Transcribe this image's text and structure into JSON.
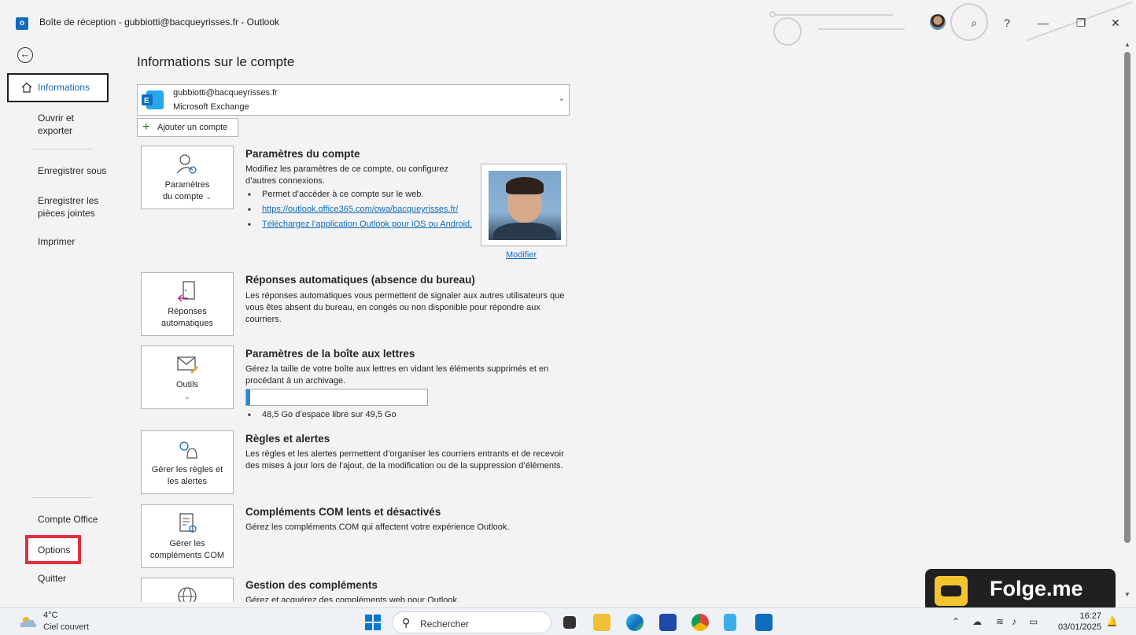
{
  "titlebar": {
    "title": "Boîte de réception - gubbiotti@bacqueyrisses.fr  -  Outlook",
    "app_icon_letter": "o",
    "help": "?"
  },
  "nav": {
    "items": [
      {
        "label": "Informations",
        "selected": true
      },
      {
        "label": "Ouvrir et exporter"
      },
      {
        "label": "Enregistrer sous"
      },
      {
        "label": "Enregistrer les pièces jointes"
      },
      {
        "label": "Imprimer"
      },
      {
        "label": "Compte Office"
      },
      {
        "label": "Options",
        "highlighted": true
      },
      {
        "label": "Quitter"
      }
    ],
    "lines": {
      "ouvrir": [
        "Ouvrir et",
        "exporter"
      ],
      "pieces": [
        "Enregistrer les",
        "pièces jointes"
      ]
    }
  },
  "main": {
    "title": "Informations sur le compte",
    "account": {
      "email": "gubbiotti@bacqueyrisses.fr",
      "type": "Microsoft Exchange",
      "icon_letter": "E"
    },
    "add_account": "Ajouter un compte",
    "sections": {
      "account_settings": {
        "tile_lines": [
          "Paramètres",
          "du compte"
        ],
        "title": "Paramètres du compte",
        "text": "Modifiez les paramètres de ce compte, ou configurez d’autres connexions.",
        "bullet1": "Permet d’accéder à ce compte sur le web.",
        "link1": "https://outlook.office365.com/owa/bacqueyrisses.fr/",
        "link2": "Téléchargez l’application Outlook pour iOS ou Android.",
        "photo_link": "Modifier"
      },
      "auto_replies": {
        "tile_lines": [
          "Réponses",
          "automatiques"
        ],
        "title": "Réponses automatiques (absence du bureau)",
        "text": "Les réponses automatiques vous permettent de signaler aux autres utilisateurs que vous êtes absent du bureau, en congés ou non disponible pour répondre aux courriers."
      },
      "mailbox": {
        "tile_label": "Outils",
        "title": "Paramètres de la boîte aux lettres",
        "text": "Gérez la taille de votre boîte aux lettres en vidant les éléments supprimés et en procédant à un archivage.",
        "storage_used_fraction": 0.02,
        "storage_text": "48,5 Go d’espace libre sur 49,5 Go"
      },
      "rules": {
        "tile_lines": [
          "Gérer les règles et",
          "les alertes"
        ],
        "title": "Règles et alertes",
        "text": "Les règles et les alertes permettent d’organiser les courriers entrants et de recevoir des mises à jour lors de l’ajout, de la modification ou de la suppression d’éléments."
      },
      "com": {
        "tile_lines": [
          "Gérer les",
          "compléments COM"
        ],
        "title": "Compléments COM lents et désactivés",
        "text": "Gérez les compléments COM qui affectent votre expérience Outlook."
      },
      "addins": {
        "title": "Gestion des compléments",
        "text": "Gérez et acquérez des compléments web pour Outlook."
      }
    }
  },
  "watermark": {
    "text": "Folge.me"
  },
  "taskbar": {
    "temp": "4°C",
    "condition": "Ciel couvert",
    "search_placeholder": "Rechercher",
    "time": "16:27",
    "date": "03/01/2025"
  },
  "colors": {
    "accent": "#0f6cbd",
    "highlight": "#e03140",
    "link": "#0f6cbd"
  }
}
